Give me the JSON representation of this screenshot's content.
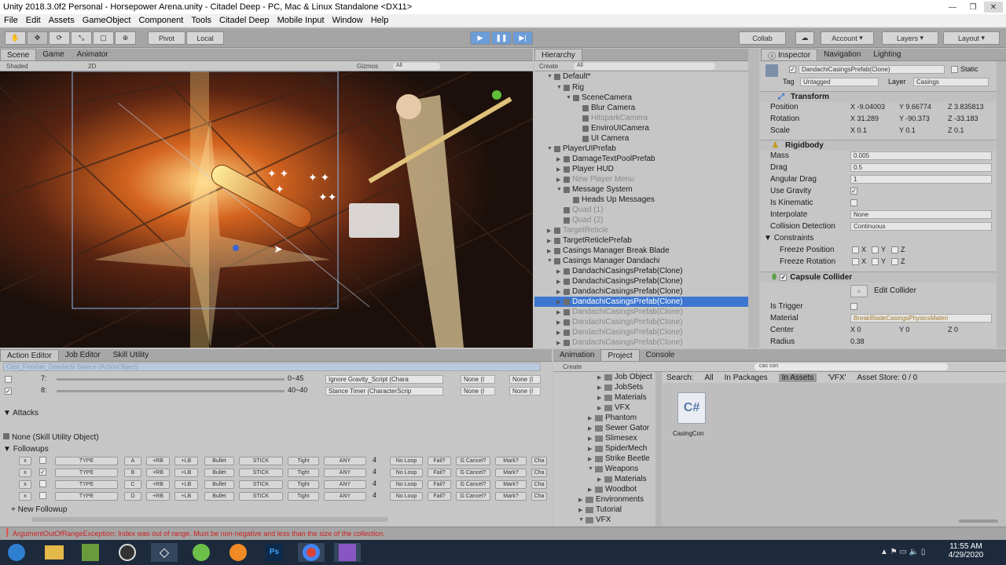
{
  "window": {
    "title": "Unity 2018.3.0f2 Personal - Horsepower Arena.unity - Citadel Deep - PC, Mac & Linux Standalone <DX11>"
  },
  "menu": [
    "File",
    "Edit",
    "Assets",
    "GameObject",
    "Component",
    "Tools",
    "Citadel Deep",
    "Mobile Input",
    "Window",
    "Help"
  ],
  "toolbar": {
    "pivot": "Pivot",
    "local": "Local",
    "collab": "Collab",
    "account": "Account",
    "layers": "Layers",
    "layout": "Layout"
  },
  "scene": {
    "tabs": [
      "Scene",
      "Game",
      "Animator"
    ],
    "shading": "Shaded",
    "mode2d": "2D",
    "gizmos": "Gizmos",
    "search": "All"
  },
  "hierarchy": {
    "tab": "Hierarchy",
    "create": "Create",
    "search": "All",
    "root": "Default*",
    "items": [
      {
        "label": "Rig",
        "depth": 2,
        "fold": "▼"
      },
      {
        "label": "SceneCamera",
        "depth": 3,
        "fold": "▼"
      },
      {
        "label": "Blur Camera",
        "depth": 4,
        "fold": ""
      },
      {
        "label": "HitsparkCamera",
        "depth": 4,
        "fold": "",
        "dim": true
      },
      {
        "label": "EnviroUICamera",
        "depth": 4,
        "fold": ""
      },
      {
        "label": "UI Camera",
        "depth": 4,
        "fold": ""
      },
      {
        "label": "PlayerUIPrefab",
        "depth": 1,
        "fold": "▼"
      },
      {
        "label": "DamageTextPoolPrefab",
        "depth": 2,
        "fold": "▶"
      },
      {
        "label": "Player HUD",
        "depth": 2,
        "fold": "▶"
      },
      {
        "label": "New Player Menu",
        "depth": 2,
        "fold": "▶",
        "dim": true
      },
      {
        "label": "Message System",
        "depth": 2,
        "fold": "▼"
      },
      {
        "label": "Heads Up Messages",
        "depth": 3,
        "fold": ""
      },
      {
        "label": "Quad (1)",
        "depth": 2,
        "fold": "",
        "dim": true
      },
      {
        "label": "Quad (2)",
        "depth": 2,
        "fold": "",
        "dim": true
      },
      {
        "label": "TargetReticle",
        "depth": 1,
        "fold": "▶",
        "dim": true
      },
      {
        "label": "TargetReticlePrefab",
        "depth": 1,
        "fold": "▶"
      },
      {
        "label": "Casings Manager Break Blade",
        "depth": 1,
        "fold": "▶"
      },
      {
        "label": "Casings Manager Dandachi",
        "depth": 1,
        "fold": "▼"
      },
      {
        "label": "DandachiCasingsPrefab(Clone)",
        "depth": 2,
        "fold": "▶"
      },
      {
        "label": "DandachiCasingsPrefab(Clone)",
        "depth": 2,
        "fold": "▶"
      },
      {
        "label": "DandachiCasingsPrefab(Clone)",
        "depth": 2,
        "fold": "▶"
      },
      {
        "label": "DandachiCasingsPrefab(Clone)",
        "depth": 2,
        "fold": "▶",
        "selected": true
      },
      {
        "label": "DandachiCasingsPrefab(Clone)",
        "depth": 2,
        "fold": "▶",
        "dim": true
      },
      {
        "label": "DandachiCasingsPrefab(Clone)",
        "depth": 2,
        "fold": "▶",
        "dim": true
      },
      {
        "label": "DandachiCasingsPrefab(Clone)",
        "depth": 2,
        "fold": "▶",
        "dim": true
      },
      {
        "label": "DandachiCasingsPrefab(Clone)",
        "depth": 2,
        "fold": "▶",
        "dim": true
      }
    ]
  },
  "inspector": {
    "tabs": [
      "Inspector",
      "Navigation",
      "Lighting"
    ],
    "object_name": "DandachiCasingsPrefab(Clone)",
    "static_label": "Static",
    "tag_label": "Tag",
    "tag": "Untagged",
    "layer_label": "Layer",
    "layer": "Casings",
    "transform": {
      "title": "Transform",
      "position": {
        "label": "Position",
        "x": "-9.04003",
        "y": "9.66774",
        "z": "3.835813"
      },
      "rotation": {
        "label": "Rotation",
        "x": "31.289",
        "y": "-90.373",
        "z": "-33.183"
      },
      "scale": {
        "label": "Scale",
        "x": "0.1",
        "y": "0.1",
        "z": "0.1"
      }
    },
    "rigidbody": {
      "title": "Rigidbody",
      "mass": {
        "label": "Mass",
        "value": "0.005"
      },
      "drag": {
        "label": "Drag",
        "value": "0.5"
      },
      "angular_drag": {
        "label": "Angular Drag",
        "value": "1"
      },
      "use_gravity": {
        "label": "Use Gravity",
        "checked": "✓"
      },
      "is_kinematic": {
        "label": "Is Kinematic"
      },
      "interpolate": {
        "label": "Interpolate",
        "value": "None"
      },
      "collision": {
        "label": "Collision Detection",
        "value": "Continuous"
      },
      "constraints": "Constraints",
      "freeze_position": "Freeze Position",
      "freeze_rotation": "Freeze Rotation",
      "axes": [
        "X",
        "Y",
        "Z"
      ]
    },
    "capsule": {
      "title": "Capsule Collider",
      "edit": "Edit Collider",
      "is_trigger": "Is Trigger",
      "material_label": "Material",
      "material": "BreakBladeCasingsPhysicsMateri",
      "center": {
        "label": "Center",
        "x": "0",
        "y": "0",
        "z": "0"
      },
      "radius": {
        "label": "Radius",
        "value": "0.38"
      }
    }
  },
  "action_editor": {
    "tabs": [
      "Action Editor",
      "Job Editor",
      "Skill Utility"
    ],
    "header_text": "Cast_Finisher_Dandachi Stance (ActionObject)",
    "rows": [
      {
        "num": "7:",
        "range": "0~45",
        "script": "Ignore Gravity_Script (Chara",
        "none1": "None (I",
        "none2": "None (I"
      },
      {
        "num": "8:",
        "range": "40~40",
        "script": "Stance Timer (CharacterScrip",
        "none1": "None (I",
        "none2": "None (I"
      }
    ],
    "attacks": "Attacks",
    "skill_utility": "None (Skill Utility Object)",
    "followups_label": "Followups",
    "followups": [
      {
        "x": "x",
        "chk": "",
        "type": "TYPE",
        "key": "A",
        "rb": "+RB",
        "lb": "+LB",
        "bullet": "Bullet",
        "stick": "STICK",
        "tight": "Tight",
        "any": "ANY",
        "n": "4",
        "loop": "No Loop",
        "fail": "Fail?",
        "cancel": "G Cancel?",
        "mark": "Mark?",
        "ch": "Cha"
      },
      {
        "x": "x",
        "chk": "✓",
        "type": "TYPE",
        "key": "B",
        "rb": "+RB",
        "lb": "+LB",
        "bullet": "Bullet",
        "stick": "STICK",
        "tight": "Tight",
        "any": "ANY",
        "n": "4",
        "loop": "No Loop",
        "fail": "Fail?",
        "cancel": "G Cancel?",
        "mark": "Mark?",
        "ch": "Cha"
      },
      {
        "x": "x",
        "chk": "",
        "type": "TYPE",
        "key": "C",
        "rb": "+RB",
        "lb": "+LB",
        "bullet": "Bullet",
        "stick": "STICK",
        "tight": "Tight",
        "any": "ANY",
        "n": "4",
        "loop": "No Loop",
        "fail": "Fail?",
        "cancel": "G Cancel?",
        "mark": "Mark?",
        "ch": "Cha"
      },
      {
        "x": "x",
        "chk": "",
        "type": "TYPE",
        "key": "D",
        "rb": "+RB",
        "lb": "+LB",
        "bullet": "Bullet",
        "stick": "STICK",
        "tight": "Tight",
        "any": "ANY",
        "n": "4",
        "loop": "No Loop",
        "fail": "Fail?",
        "cancel": "G Cancel?",
        "mark": "Mark?",
        "ch": "Cha"
      }
    ],
    "new_followup": "+ New Followup"
  },
  "project": {
    "tabs": [
      "Animation",
      "Project",
      "Console"
    ],
    "create": "Create",
    "search_value": "cas con",
    "search_label": "Search:",
    "filters": [
      "All",
      "In Packages",
      "In Assets",
      "'VFX'"
    ],
    "asset_store": "Asset Store: 0 / 0",
    "tree": [
      {
        "label": "Job Object",
        "depth": 5
      },
      {
        "label": "JobSets",
        "depth": 5
      },
      {
        "label": "Materials",
        "depth": 5
      },
      {
        "label": "VFX",
        "depth": 5
      },
      {
        "label": "Phantom",
        "depth": 4
      },
      {
        "label": "Sewer Gator",
        "depth": 4
      },
      {
        "label": "Slimesex",
        "depth": 4
      },
      {
        "label": "SpiderMech",
        "depth": 4
      },
      {
        "label": "Strike Beetle",
        "depth": 4
      },
      {
        "label": "Weapons",
        "depth": 4
      },
      {
        "label": "Materials",
        "depth": 5
      },
      {
        "label": "Woodbot",
        "depth": 4
      },
      {
        "label": "Environments",
        "depth": 3
      },
      {
        "label": "Tutorial",
        "depth": 3
      },
      {
        "label": "VFX",
        "depth": 3
      }
    ],
    "asset": {
      "icon": "C#",
      "name": "CasingCon"
    }
  },
  "status": {
    "error": "ArgumentOutOfRangeException: Index was out of range. Must be non-negative and less than the size of the collection."
  },
  "taskbar": {
    "time": "11:55 AM",
    "date": "4/29/2020",
    "apps": [
      "windows-start",
      "file-explorer",
      "minecraft",
      "obs",
      "unity",
      "gamemaker",
      "blender",
      "photoshop",
      "chrome",
      "visual-studio"
    ]
  },
  "colors": {
    "selection": "#3e77d1",
    "error": "#cc2222",
    "accent": "#6b9dd8"
  }
}
